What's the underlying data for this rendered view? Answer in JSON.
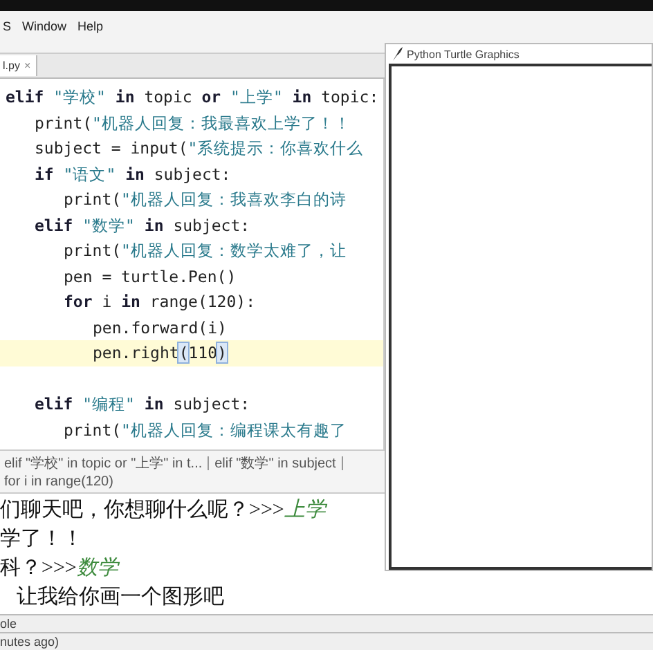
{
  "menu": [
    "S",
    "Window",
    "Help"
  ],
  "editor_tab": {
    "label": "l.py",
    "close": "×"
  },
  "code": [
    {
      "current": false,
      "blank_before": false,
      "tokens": [
        {
          "kind": "keyword",
          "text": "elif "
        },
        {
          "kind": "string",
          "text": "\"学校\""
        },
        {
          "kind": "keyword",
          "text": " in"
        },
        {
          "kind": "plain",
          "text": " topic "
        },
        {
          "kind": "keyword",
          "text": "or "
        },
        {
          "kind": "string",
          "text": "\"上学\""
        },
        {
          "kind": "keyword",
          "text": " in"
        },
        {
          "kind": "plain",
          "text": " topic:"
        }
      ],
      "children": [
        {
          "current": false,
          "blank_before": false,
          "tokens": [
            {
              "kind": "plain",
              "text": "print("
            },
            {
              "kind": "string",
              "text": "\"机器人回复：我最喜欢上学了！！"
            }
          ]
        },
        {
          "current": false,
          "blank_before": false,
          "tokens": [
            {
              "kind": "plain",
              "text": "subject = input("
            },
            {
              "kind": "string",
              "text": "\"系统提示：你喜欢什么"
            }
          ]
        },
        {
          "current": false,
          "blank_before": false,
          "tokens": [
            {
              "kind": "keyword",
              "text": "if "
            },
            {
              "kind": "string",
              "text": "\"语文\""
            },
            {
              "kind": "keyword",
              "text": " in"
            },
            {
              "kind": "plain",
              "text": " subject:"
            }
          ],
          "children": [
            {
              "current": false,
              "blank_before": false,
              "tokens": [
                {
                  "kind": "plain",
                  "text": "print("
                },
                {
                  "kind": "string",
                  "text": "\"机器人回复：我喜欢李白的诗"
                }
              ]
            }
          ]
        },
        {
          "current": false,
          "blank_before": false,
          "tokens": [
            {
              "kind": "keyword",
              "text": "elif "
            },
            {
              "kind": "string",
              "text": "\"数学\""
            },
            {
              "kind": "keyword",
              "text": " in"
            },
            {
              "kind": "plain",
              "text": " subject:"
            }
          ],
          "children": [
            {
              "current": false,
              "blank_before": false,
              "tokens": [
                {
                  "kind": "plain",
                  "text": "print("
                },
                {
                  "kind": "string",
                  "text": "\"机器人回复：数学太难了，让"
                }
              ]
            },
            {
              "current": false,
              "blank_before": false,
              "tokens": [
                {
                  "kind": "plain",
                  "text": "pen = turtle.Pen()"
                }
              ]
            },
            {
              "current": false,
              "blank_before": false,
              "tokens": [
                {
                  "kind": "keyword",
                  "text": "for"
                },
                {
                  "kind": "plain",
                  "text": " i "
                },
                {
                  "kind": "keyword",
                  "text": "in"
                },
                {
                  "kind": "plain",
                  "text": " range(120):"
                }
              ],
              "children": [
                {
                  "current": false,
                  "blank_before": false,
                  "tokens": [
                    {
                      "kind": "plain",
                      "text": "pen.forward(i)"
                    }
                  ]
                },
                {
                  "current": true,
                  "blank_before": false,
                  "tokens": [
                    {
                      "kind": "plain",
                      "text": "pen.right"
                    },
                    {
                      "kind": "bracket",
                      "text": "("
                    },
                    {
                      "kind": "plain",
                      "text": "110"
                    },
                    {
                      "kind": "bracket",
                      "text": ")"
                    }
                  ]
                }
              ]
            }
          ]
        },
        {
          "current": false,
          "blank_before": true,
          "tokens": [
            {
              "kind": "keyword",
              "text": "elif "
            },
            {
              "kind": "string",
              "text": "\"编程\""
            },
            {
              "kind": "keyword",
              "text": " in"
            },
            {
              "kind": "plain",
              "text": " subject:"
            }
          ],
          "children": [
            {
              "current": false,
              "blank_before": false,
              "tokens": [
                {
                  "kind": "plain",
                  "text": "print("
                },
                {
                  "kind": "string",
                  "text": "\"机器人回复：编程课太有趣了"
                }
              ]
            }
          ]
        }
      ]
    }
  ],
  "breadcrumb": [
    "elif \"学校\" in topic or \"上学\" in t...",
    "elif \"数学\" in subject",
    "for i in range(120)"
  ],
  "console": [
    {
      "indent": false,
      "parts": [
        {
          "kind": "output",
          "text": "们聊天吧，你想聊什么呢？>>>"
        },
        {
          "kind": "input",
          "text": "上学"
        }
      ]
    },
    {
      "indent": false,
      "parts": [
        {
          "kind": "output",
          "text": "学了！！"
        }
      ]
    },
    {
      "indent": false,
      "parts": [
        {
          "kind": "output",
          "text": "科？>>>"
        },
        {
          "kind": "input",
          "text": "数学"
        }
      ]
    },
    {
      "indent": true,
      "parts": [
        {
          "kind": "output",
          "text": "让我给你画一个图形吧"
        }
      ]
    }
  ],
  "turtle_window": {
    "title": "Python Turtle Graphics"
  },
  "status_bars": [
    "ole",
    "nutes ago)"
  ]
}
